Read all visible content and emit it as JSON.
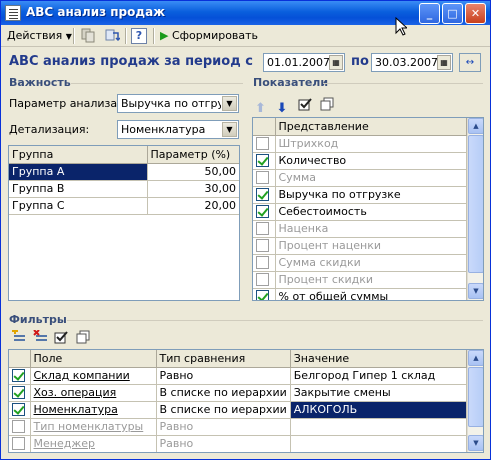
{
  "window": {
    "title": "ABC анализ продаж",
    "buttons": {
      "minimize": "_",
      "maximize": "□",
      "close": "✕"
    }
  },
  "toolbar": {
    "actions_label": "Действия",
    "help_label": "?",
    "generate_label": "Сформировать"
  },
  "header": {
    "title": "ABC анализ продаж за период с",
    "date_from": "01.01.2007",
    "to_label": "по",
    "date_to": "30.03.2007"
  },
  "importance": {
    "heading": "Важность",
    "param_label": "Параметр анализа:",
    "param_value": "Выручка по отгрузке",
    "detail_label": "Детализация:",
    "detail_value": "Номенклатура",
    "columns": [
      "Группа",
      "Параметр (%)"
    ],
    "rows": [
      {
        "group": "Группа А",
        "value": "50,00"
      },
      {
        "group": "Группа B",
        "value": "30,00"
      },
      {
        "group": "Группа C",
        "value": "20,00"
      }
    ]
  },
  "indicators": {
    "heading": "Показатели",
    "column": "Представление",
    "items": [
      {
        "label": "Штрихкод",
        "checked": false,
        "active": false
      },
      {
        "label": "Количество",
        "checked": true,
        "active": true
      },
      {
        "label": "Сумма",
        "checked": false,
        "active": false
      },
      {
        "label": "Выручка по отгрузке",
        "checked": true,
        "active": true
      },
      {
        "label": "Себестоимость",
        "checked": true,
        "active": true
      },
      {
        "label": "Наценка",
        "checked": false,
        "active": false
      },
      {
        "label": "Процент наценки",
        "checked": false,
        "active": false
      },
      {
        "label": "Сумма скидки",
        "checked": false,
        "active": false
      },
      {
        "label": "Процент скидки",
        "checked": false,
        "active": false
      },
      {
        "label": "% от общей суммы",
        "checked": true,
        "active": true
      }
    ]
  },
  "filters": {
    "heading": "Фильтры",
    "columns": [
      "Поле",
      "Тип сравнения",
      "Значение"
    ],
    "rows": [
      {
        "field": "Склад компании",
        "type": "Равно",
        "value": "Белгород Гипер 1 склад",
        "checked": true,
        "active": true
      },
      {
        "field": "Хоз. операция",
        "type": "В списке по иерархии",
        "value": "Закрытие смены",
        "checked": true,
        "active": true
      },
      {
        "field": "Номенклатура",
        "type": "В списке по иерархии",
        "value": "АЛКОГОЛЬ",
        "checked": true,
        "active": true
      },
      {
        "field": "Тип номенклатуры",
        "type": "Равно",
        "value": "",
        "checked": false,
        "active": false
      },
      {
        "field": "Менеджер",
        "type": "Равно",
        "value": "",
        "checked": false,
        "active": false
      }
    ]
  }
}
